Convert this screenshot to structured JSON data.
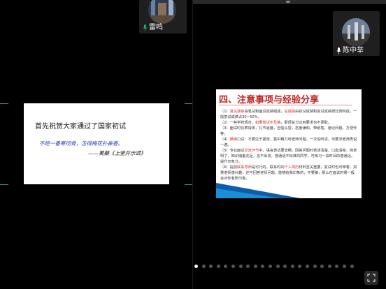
{
  "participants": [
    {
      "name": "雷鸣"
    },
    {
      "name": "陈中举"
    }
  ],
  "slide1": {
    "title": "首先祝贺大家通过了国家初试",
    "quote": "不经一番寒彻骨，怎得梅花扑鼻香。",
    "source": "——黄蘗《上堂开示颂》"
  },
  "slide2": {
    "title": "四、注意事项与经验分享",
    "items": [
      {
        "pre": "（1）",
        "hl": "复试成绩",
        "text": "由笔试和面试成绩组成，",
        "hl2": "总成绩",
        "post": "由初试成绩和复试成绩按比例构成，一般复试成绩占30~50%。"
      },
      {
        "pre": "（2）一些学校规定，",
        "hl": "如果笔试不及格",
        "text": "，即便总分达到要求也不录取。",
        "hl2": "",
        "post": ""
      },
      {
        "pre": "（3）面试时仪表得体，礼节适度，自信从容，态度谦和，带纸笔，速记问题，方便作答。",
        "hl": "",
        "text": "",
        "hl2": "",
        "post": ""
      },
      {
        "pre": "（4）",
        "hl": "精读",
        "text": "口试：不要过于紧张，集中精力听老师问题，一次没听清，可要求老师再说一遍。",
        "hl2": "",
        "post": ""
      },
      {
        "pre": "（5）专业面试",
        "hl": "交流环节",
        "text": "中，语言表达要流畅，回答问题时表述清楚，口齿清晰，简单明了，知识储备充足，言不出贪，普通话不标准的同学，可练习一段时间的普通话，提升印象分。",
        "hl2": "",
        "post": ""
      },
      {
        "pre": "（6）提前",
        "hl": "联系导师",
        "text": "是可行的，联系时的",
        "hl2": "个人简历",
        "post": "材料至关重要，复试时也可带着，如果老师感兴趣，还可回答老师问题，能够给我印象的，不要稿，那么在面试时候一般会对你有所印象。"
      }
    ]
  },
  "pager": {
    "count": 22,
    "active": 0
  },
  "colors": {
    "accent_green": "#1fa36a",
    "slide_title_red": "#c41f1f",
    "slide_quote_blue": "#2b3fc8"
  }
}
